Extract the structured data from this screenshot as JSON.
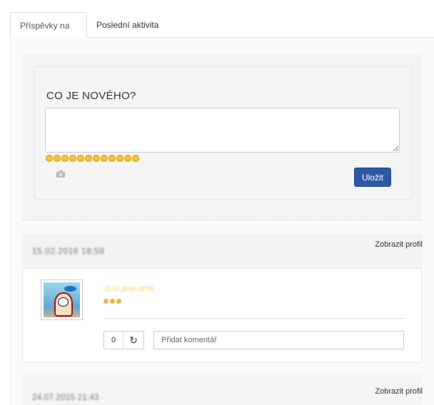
{
  "tabs": [
    {
      "label": "Příspěvky na zdi",
      "active": true
    },
    {
      "label": "Poslední aktivita",
      "active": false
    }
  ],
  "composer": {
    "title": "CO JE NOVÉHO?",
    "textarea_value": "",
    "emoji_count": 12,
    "camera_icon": "camera-icon",
    "save_label": "Uložit"
  },
  "posts": [
    {
      "date": "15.02.2016 18:59",
      "profile_link": "Zobrazit profil",
      "meta": "15.02.2016 18:59",
      "avatar_icon": "cartoon-avatar",
      "comment_count": "0",
      "refresh_icon": "refresh-icon",
      "comment_placeholder": "Přidat komentář"
    },
    {
      "date": "24.07.2015 21:43",
      "profile_link": "Zobrazit profil"
    }
  ],
  "colors": {
    "accent": "#2d58a6",
    "emoji": "#f4c430",
    "blurred_meta": "#f0c53e"
  }
}
